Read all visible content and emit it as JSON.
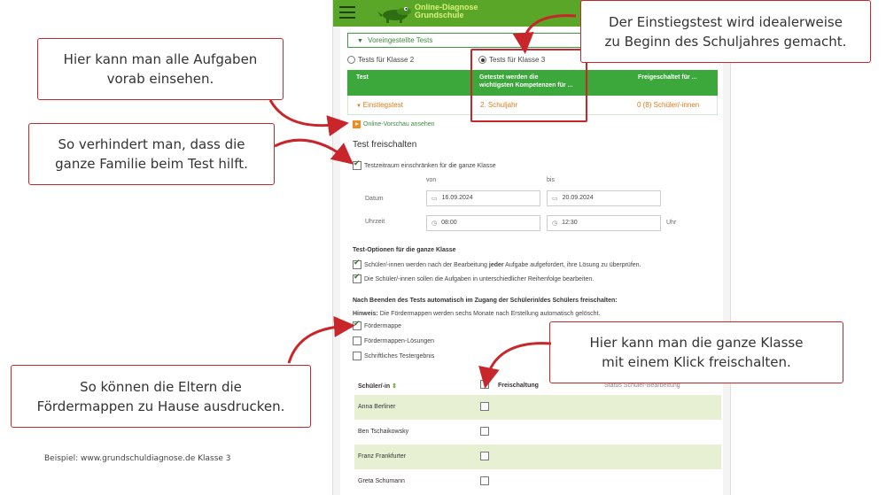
{
  "app": {
    "logo_line1": "Online-Diagnose",
    "logo_line2": "Grundschule",
    "accordion_title": "Voreingestellte Tests",
    "radios": [
      {
        "label": "Tests für Klasse 2",
        "selected": false
      },
      {
        "label": "Tests für Klasse 3",
        "selected": true
      }
    ],
    "table": {
      "headers": [
        "Test",
        "Getestet werden die",
        "wichtigsten Kompetenzen für ...",
        "Freigeschaltet für ..."
      ],
      "row": {
        "test": "Einstiegstest",
        "period": "2. Schuljahr",
        "unlocked": "0 (8) Schüler/-innen"
      }
    },
    "preview_link": "Online-Vorschau ansehen",
    "release_title": "Test freischalten",
    "restrict_label": "Testzeitraum einschränken für die ganze Klasse",
    "von": "von",
    "bis": "bis",
    "date_label": "Datum",
    "time_label": "Uhrzeit",
    "date_from": "16.09.2024",
    "date_to": "20.09.2024",
    "time_from": "08:00",
    "time_to": "12:30",
    "uhr": "Uhr",
    "options_title": "Test-Optionen für die ganze Klasse",
    "option1_pre": "Schüler/-innen werden nach der Bearbeitung ",
    "option1_bold": "jeder",
    "option1_post": " Aufgabe aufgefordert, ihre Lösung zu überprüfen.",
    "option2": "Die Schüler/-innen sollen die Aufgaben in unterschiedlicher Reihenfolge bearbeiten.",
    "after_title": "Nach Beenden des Tests automatisch im Zugang der Schülerin/des Schülers freischalten:",
    "hint_bold": "Hinweis:",
    "hint_text": " Die Fördermappen werden sechs Monate nach Erstellung automatisch gelöscht.",
    "release_items": [
      {
        "label": "Fördermappe",
        "checked": true
      },
      {
        "label": "Fördermappen-Lösungen",
        "checked": false
      },
      {
        "label": "Schriftliches Testergebnis",
        "checked": false
      }
    ],
    "students_header": {
      "name": "Schüler/-in",
      "sort_icon": "sort-icon",
      "release": "Freischaltung",
      "status": "Status Schüler-Bearbeitung"
    },
    "students": [
      "Anna Berliner",
      "Ben Tschaikowsky",
      "Franz Frankfurter",
      "Greta Schumann"
    ]
  },
  "notes": {
    "top_right": [
      "Der Einstiegstest wird idealerweise",
      "zu Beginn des Schuljahres gemacht."
    ],
    "left1": [
      "Hier kann man alle Aufgaben",
      "vorab einsehen."
    ],
    "left2": [
      "So verhindert man, dass die",
      "ganze Familie beim Test hilft."
    ],
    "right_mid": [
      "Hier kann man die ganze Klasse",
      "mit einem Klick freischalten."
    ],
    "left3": [
      "So können die Eltern die",
      "Fördermappen zu Hause ausdrucken."
    ]
  },
  "footer": "Beispiel: www.grundschuldiagnose.de Klasse 3",
  "colors": {
    "brand_green": "#5aa629",
    "table_green": "#3ca83c",
    "accent_orange": "#e07b18",
    "annotation_red": "#c8262a",
    "row_alt": "#e8f0d4"
  }
}
